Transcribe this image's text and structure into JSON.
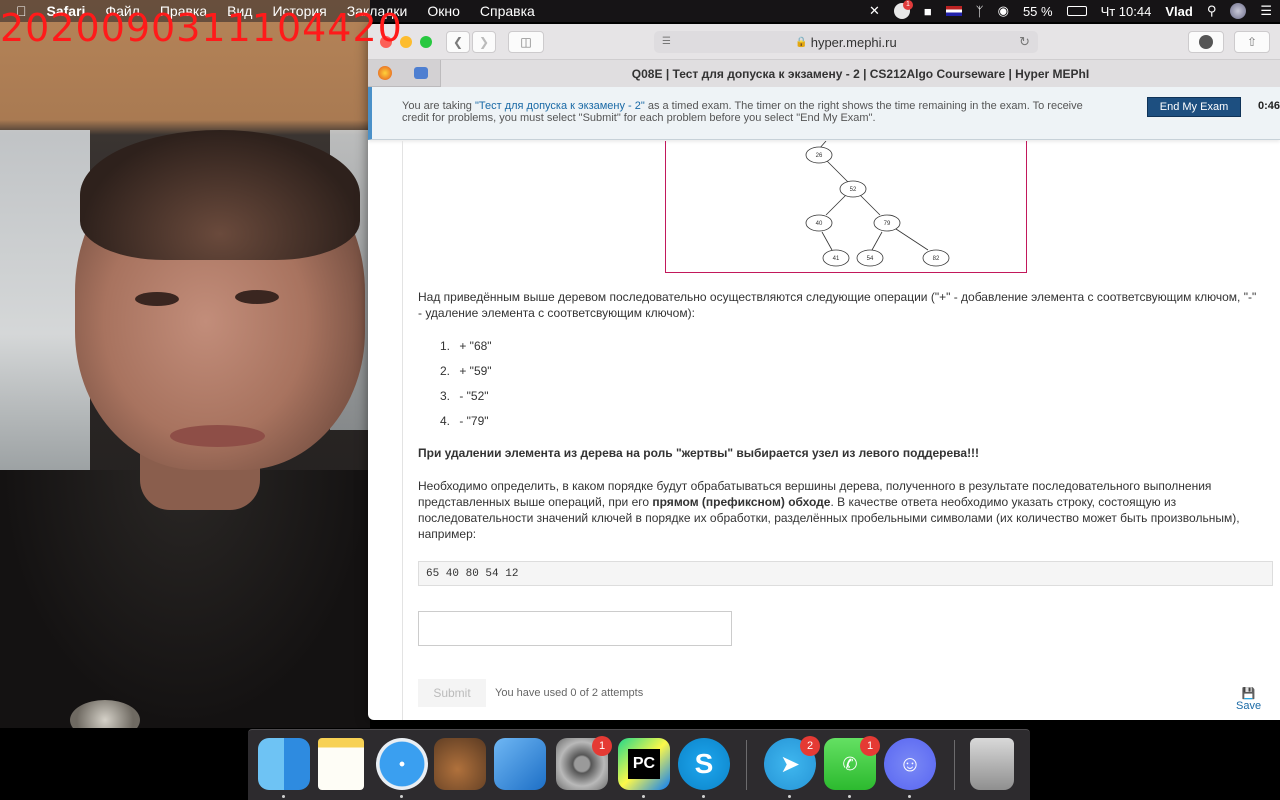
{
  "overlay": {
    "timestamp": "2020090311104420"
  },
  "menubar": {
    "apple": "",
    "items": [
      "Safari",
      "Файл",
      "Правка",
      "Вид",
      "История",
      "Закладки",
      "Окно",
      "Справка"
    ],
    "battery": "55 %",
    "clock": "Чт 10:44",
    "user": "Vlad",
    "notif_badge": "1"
  },
  "browser": {
    "url": "hyper.mephi.ru",
    "tab_title": "Q08E | Тест для допуска к экзамену - 2 | CS212Algo Courseware | Hyper MEPhI"
  },
  "banner": {
    "text_before": "You are taking ",
    "exam_link": "\"Тест для допуска к экзамену - 2\"",
    "text_after": " as a timed exam. The timer on the right shows the time remaining in the exam. To receive credit for problems, you must select \"Submit\" for each problem before you select \"End My Exam\".",
    "end_button": "End My Exam",
    "timer": "0:46:"
  },
  "tree": {
    "nodes": [
      {
        "label": "26"
      },
      {
        "label": "52"
      },
      {
        "label": "40"
      },
      {
        "label": "79"
      },
      {
        "label": "41"
      },
      {
        "label": "54"
      },
      {
        "label": "82"
      }
    ]
  },
  "problem": {
    "intro": "Над приведённым выше деревом последовательно осуществляются следующие операции (\"+\" - добавление элемента с соответсвующим ключом, \"-\" - удаление элемента с соответсвующим ключом):",
    "operations": [
      {
        "num": "1.",
        "text": "+ \"68\""
      },
      {
        "num": "2.",
        "text": "+ \"59\""
      },
      {
        "num": "3.",
        "text": "- \"52\""
      },
      {
        "num": "4.",
        "text": "- \"79\""
      }
    ],
    "warning": "При удалении элемента из дерева на роль \"жертвы\" выбирается узел из левого поддерева!!!",
    "question_part1": "Необходимо определить, в каком порядке будут обрабатываться вершины дерева, полученного в результате последовательного выполнения представленных выше операций, при его ",
    "question_bold": "прямом (префиксном) обходе",
    "question_part2": ". В качестве ответа необходимо указать строку, состоящую из последовательности значений ключей в порядке их обработки, разделённых пробельными символами (их количество может быть произвольным), например:",
    "example": "65 40 80 54 12",
    "answer_value": "",
    "submit": "Submit",
    "attempts": "You have used 0 of 2 attempts",
    "save": "Save"
  },
  "dock": {
    "apps": [
      {
        "name": "Finder",
        "badge": ""
      },
      {
        "name": "Notes",
        "badge": ""
      },
      {
        "name": "Safari",
        "badge": ""
      },
      {
        "name": "Instruments",
        "badge": ""
      },
      {
        "name": "Xcode",
        "badge": ""
      },
      {
        "name": "System Preferences",
        "badge": "1"
      },
      {
        "name": "PyCharm",
        "badge": ""
      },
      {
        "name": "Skype",
        "badge": ""
      },
      {
        "name": "Telegram",
        "badge": "2"
      },
      {
        "name": "FaceTime",
        "badge": "1"
      },
      {
        "name": "Discord",
        "badge": ""
      },
      {
        "name": "Trash",
        "badge": ""
      }
    ],
    "pycharm_label": "PC"
  },
  "colors": {
    "accent": "#1d4f80",
    "link": "#1a6aa6",
    "tree_border": "#c2185b",
    "badge": "#e53a34"
  }
}
